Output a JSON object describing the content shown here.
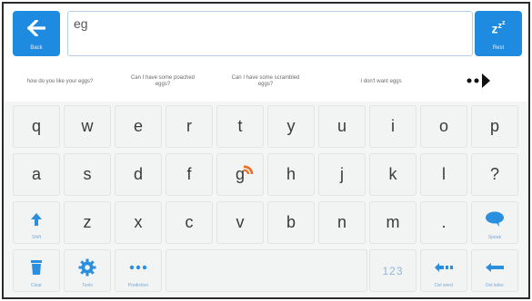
{
  "toolbar": {
    "back_label": "Back",
    "rest_label": "Rest",
    "rest_glyph": "zzz",
    "input_value": "eg"
  },
  "predictions": [
    "how do you like your eggs?",
    "Can I have some poached eggs?",
    "Can I have some scrambled eggs?",
    "I don't want eggs"
  ],
  "keyboard": {
    "row1": [
      "q",
      "w",
      "e",
      "r",
      "t",
      "y",
      "u",
      "i",
      "o",
      "p"
    ],
    "row2": [
      "a",
      "s",
      "d",
      "f",
      "g",
      "h",
      "j",
      "k",
      "l",
      "?"
    ],
    "row3": [
      "z",
      "x",
      "c",
      "v",
      "b",
      "n",
      "m",
      "."
    ],
    "shift_label": "Shift",
    "speak_label": "Speak",
    "clear_label": "Clear",
    "tools_label": "Tools",
    "prediction_label": "Prediction",
    "numbers_label": "123",
    "del_word_label": "Del word",
    "del_letter_label": "Del letter"
  },
  "colors": {
    "accent": "#1f8be0",
    "key_bg": "#f2f3f3",
    "icon_blue": "#2b8fe0",
    "highlight": "#f26a1b"
  },
  "icons": {
    "back": "arrow-left-icon",
    "rest": "sleep-icon",
    "more": "more-predictions-icon",
    "shift": "arrow-up-icon",
    "speak": "speech-bubble-icon",
    "clear": "trash-icon",
    "tools": "gear-icon",
    "prediction": "dots-icon",
    "del_word": "delete-word-icon",
    "del_letter": "backspace-icon"
  }
}
